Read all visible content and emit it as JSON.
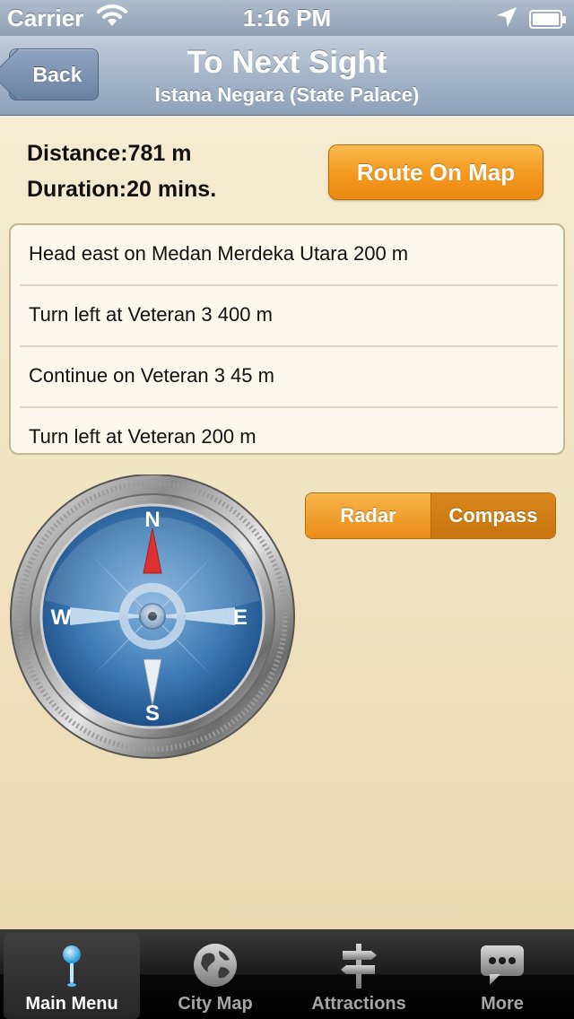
{
  "status_bar": {
    "carrier": "Carrier",
    "time": "1:16 PM",
    "icons": [
      "wifi-icon",
      "location-arrow-icon",
      "battery-icon"
    ]
  },
  "nav": {
    "back_label": "Back",
    "title": "To Next Sight",
    "subtitle": "Istana Negara (State Palace)"
  },
  "trip": {
    "distance_label": "Distance:",
    "distance_value": "781 m",
    "duration_label": "Duration:",
    "duration_value": "20 mins.",
    "route_button": "Route On Map"
  },
  "directions": [
    {
      "text": "Head east on Medan Merdeka Utara 200 m"
    },
    {
      "text": "Turn left at Veteran 3 400 m"
    },
    {
      "text": "Continue on Veteran 3 45 m"
    },
    {
      "text": "Turn left at Veteran 200 m"
    }
  ],
  "view_toggle": {
    "options": [
      "Radar",
      "Compass"
    ],
    "selected": "Compass"
  },
  "compass": {
    "north": "N",
    "south": "S",
    "east": "E",
    "west": "W"
  },
  "tab_bar": {
    "selected": "Main Menu",
    "tabs": [
      {
        "label": "Main Menu",
        "icon": "pin-icon"
      },
      {
        "label": "City Map",
        "icon": "globe-icon"
      },
      {
        "label": "Attractions",
        "icon": "signpost-icon"
      },
      {
        "label": "More",
        "icon": "chat-bubble-icon"
      }
    ]
  },
  "colors": {
    "accent_orange": "#f39a1f",
    "nav_blue": "#a4b5c9",
    "background": "#f1e5c6"
  }
}
